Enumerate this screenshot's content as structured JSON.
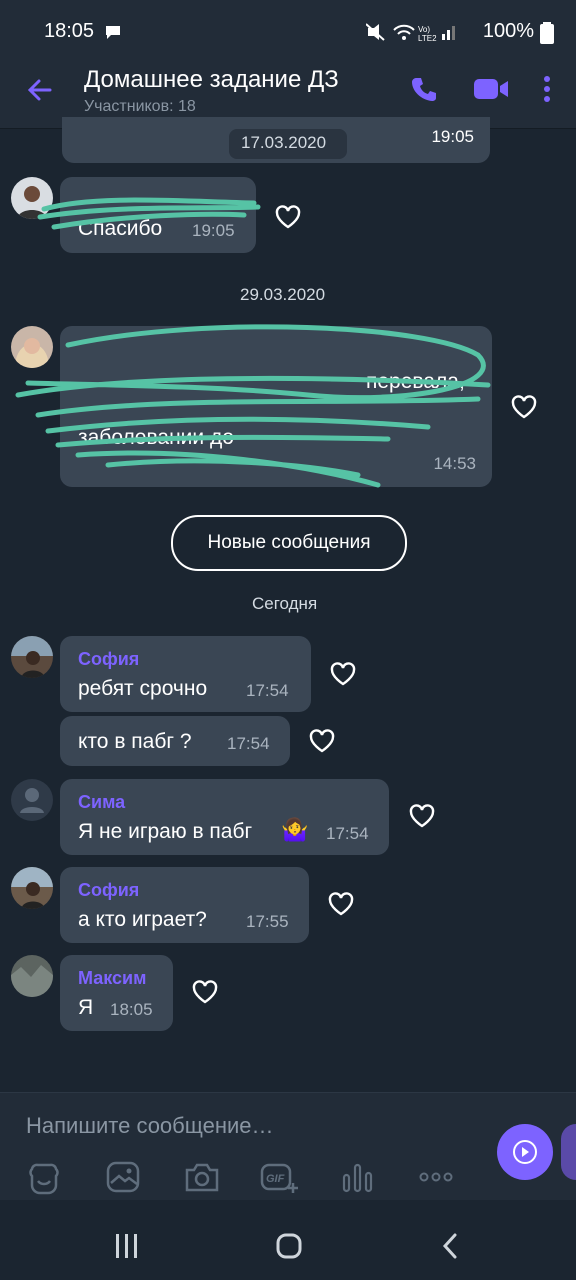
{
  "status_bar": {
    "time": "18:05",
    "battery": "100%"
  },
  "header": {
    "title": "Домашнее задание ДЗ",
    "subtitle": "Участников: 18"
  },
  "chat": {
    "top_date": "17.03.2020",
    "top_time": "19:05",
    "msg1": {
      "text": "Спасибо",
      "time": "19:05"
    },
    "date2": "29.03.2020",
    "msg2": {
      "line1": "перевала,",
      "line2": "заболевании до",
      "time": "14:53"
    },
    "new_messages_label": "Новые сообщения",
    "today_label": "Сегодня",
    "messages": [
      {
        "sender": "София",
        "text": "ребят срочно",
        "time": "17:54"
      },
      {
        "text": "кто в пабг ?",
        "time": "17:54"
      },
      {
        "sender": "Сима",
        "text": "Я не играю в пабг",
        "emoji": "🤷‍♀️",
        "time": "17:54"
      },
      {
        "sender": "София",
        "text": "а кто играет?",
        "time": "17:55"
      },
      {
        "sender": "Максим",
        "text": "Я",
        "time": "18:05"
      }
    ]
  },
  "composer": {
    "placeholder": "Напишите сообщение…"
  },
  "icons": [
    "back-arrow-icon",
    "phone-icon",
    "video-icon",
    "more-icon",
    "heart-icon",
    "sticker-icon",
    "gallery-icon",
    "camera-icon",
    "gif-icon",
    "voice-icon",
    "more-horizontal-icon",
    "send-icon"
  ],
  "colors": {
    "accent": "#7d63ff",
    "bubble": "#3a4654",
    "background": "#1b2530",
    "header": "#222c38",
    "scribble": "#56c3a5"
  }
}
